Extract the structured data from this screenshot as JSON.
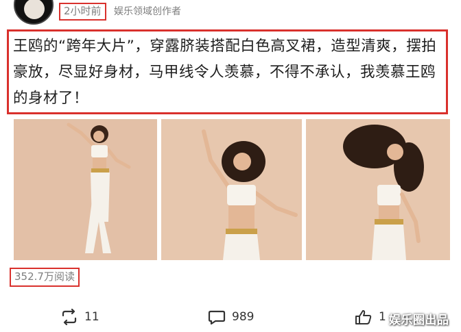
{
  "post": {
    "time_ago": "2小时前",
    "author_label": "娱乐领域创作者",
    "text": "王鸥的“跨年大片”，穿露脐装搭配白色高叉裙，造型清爽，摆拍豪放，尽显好身材，马甲线令人羡慕，不得不承认，我羡慕王鸥的身材了！",
    "reads": "352.7万阅读"
  },
  "photos": [
    {
      "icon": "photo-woman-standing"
    },
    {
      "icon": "photo-woman-dancing"
    },
    {
      "icon": "photo-woman-hair-flip"
    }
  ],
  "actions": {
    "repost_count": "11",
    "comment_count": "989",
    "like_count": "1"
  },
  "watermark": "娱乐圈出品",
  "colors": {
    "highlight": "#d9302c",
    "meta_text": "#7e7e7e",
    "photo_bg": "#e7c7ae"
  }
}
